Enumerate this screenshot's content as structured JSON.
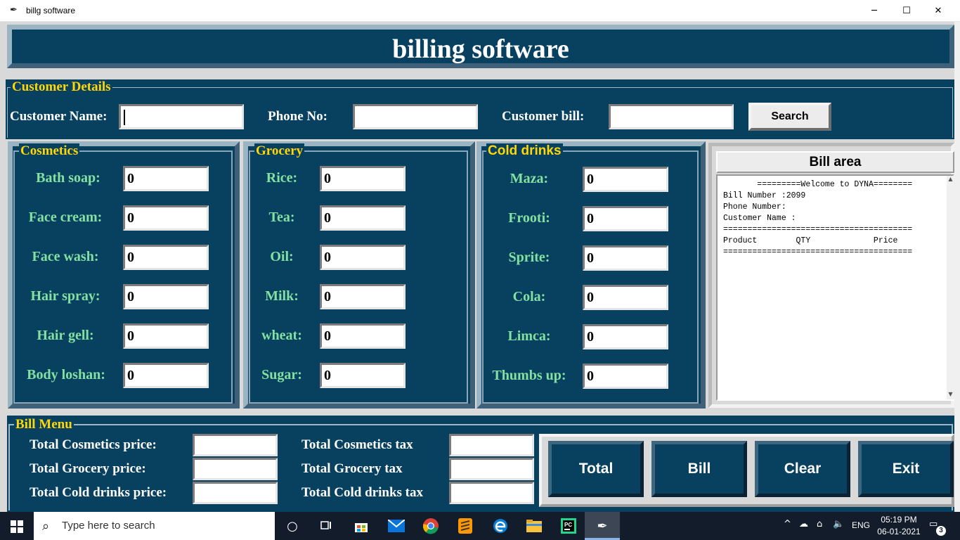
{
  "window": {
    "title": "billg software",
    "icon": "feather-icon",
    "controls": {
      "minimize": "─",
      "maximize": "☐",
      "close": "✕"
    }
  },
  "header": {
    "title": "billing software"
  },
  "customer": {
    "legend": "Customer Details",
    "name_label": "Customer Name:",
    "phone_label": "Phone No:",
    "bill_label": "Customer bill:",
    "name_value": "",
    "phone_value": "",
    "bill_value": "",
    "search_label": "Search"
  },
  "cosmetics": {
    "legend": "Cosmetics",
    "items": [
      {
        "label": "Bath soap:",
        "qty": "0"
      },
      {
        "label": "Face cream:",
        "qty": "0"
      },
      {
        "label": "Face wash:",
        "qty": "0"
      },
      {
        "label": "Hair spray:",
        "qty": "0"
      },
      {
        "label": "Hair gell:",
        "qty": "0"
      },
      {
        "label": "Body loshan:",
        "qty": "0"
      }
    ]
  },
  "grocery": {
    "legend": "Grocery",
    "items": [
      {
        "label": "Rice:",
        "qty": "0"
      },
      {
        "label": "Tea:",
        "qty": "0"
      },
      {
        "label": "Oil:",
        "qty": "0"
      },
      {
        "label": "Milk:",
        "qty": "0"
      },
      {
        "label": "wheat:",
        "qty": "0"
      },
      {
        "label": "Sugar:",
        "qty": "0"
      }
    ]
  },
  "cold_drinks": {
    "legend": "Cold drinks",
    "items": [
      {
        "label": "Maza:",
        "qty": "0"
      },
      {
        "label": "Frooti:",
        "qty": "0"
      },
      {
        "label": "Sprite:",
        "qty": "0"
      },
      {
        "label": "Cola:",
        "qty": "0"
      },
      {
        "label": "Limca:",
        "qty": "0"
      },
      {
        "label": "Thumbs up:",
        "qty": "0"
      }
    ]
  },
  "bill_area": {
    "heading": "Bill area",
    "lines": [
      "       =========Welcome to DYNA========",
      "Bill Number :2099",
      "Phone Number:",
      "Customer Name :",
      "=======================================",
      "Product        QTY             Price",
      "======================================="
    ]
  },
  "bill_menu": {
    "legend": "Bill Menu",
    "total_cosmetics_price": "Total Cosmetics price:",
    "total_grocery_price": "Total Grocery price:",
    "total_cold_drinks_price": "Total Cold drinks price:",
    "total_cosmetics_tax": "Total Cosmetics tax",
    "total_grocery_tax": "Total Grocery tax",
    "total_cold_drinks_tax": "Total Cold drinks tax",
    "buttons": {
      "total": "Total",
      "bill": "Bill",
      "clear": "Clear",
      "exit": "Exit"
    }
  },
  "taskbar": {
    "search_placeholder": "Type here to search",
    "language": "ENG",
    "time": "05:19 PM",
    "date": "06-01-2021",
    "notification_count": "3",
    "apps": [
      "task-view-icon",
      "store-icon",
      "mail-icon",
      "chrome-icon",
      "sublime-icon",
      "edge-icon",
      "file-explorer-icon",
      "pycharm-icon",
      "python-feather-icon"
    ]
  },
  "colors": {
    "navy": "#07415f",
    "legend_yellow": "#ffd60a",
    "item_green": "#84e0a1",
    "app_bg": "#d9d9d9"
  }
}
